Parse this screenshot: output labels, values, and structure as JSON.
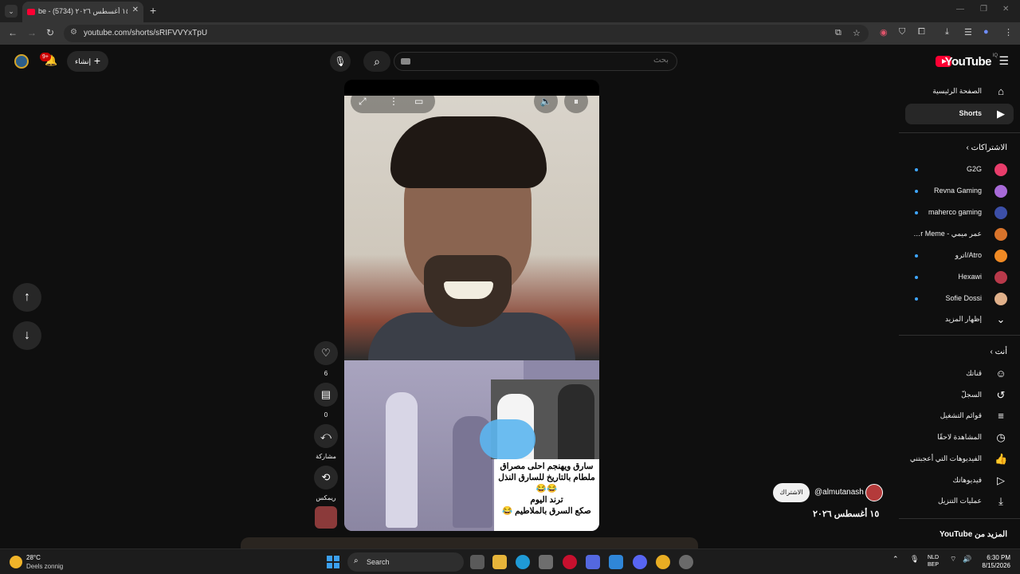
{
  "browser": {
    "tab_title": "be - ١٥ أغسطس ٢٠٢٦ (5734)",
    "url": "youtube.com/shorts/sRIFVVYxTpU"
  },
  "header": {
    "logo_text": "YouTube",
    "logo_country": "IQ",
    "search_placeholder": "بحث",
    "create_label": "إنشاء",
    "notification_count": "9+"
  },
  "sidebar": {
    "nav": [
      {
        "label": "الصفحة الرئيسية",
        "icon": "home-icon"
      },
      {
        "label": "Shorts",
        "icon": "shorts-icon",
        "active": true
      }
    ],
    "subscriptions_heading": "الاشتراكات",
    "subscriptions": [
      {
        "label": "G2G",
        "color": "#e83d6b",
        "new": true
      },
      {
        "label": "Revna Gaming",
        "color": "#a86ad8",
        "new": true
      },
      {
        "label": "maherco gaming",
        "color": "#3c4fa8",
        "new": true
      },
      {
        "label": "عمر ميمي - Omar Meme",
        "color": "#d9742b",
        "new": false
      },
      {
        "label": "Atro/اترو",
        "color": "#f08a24",
        "new": true
      },
      {
        "label": "Hexawi",
        "color": "#b8394a",
        "new": true
      },
      {
        "label": "Sofie Dossi",
        "color": "#e0b08a",
        "new": true
      }
    ],
    "show_more": "إظهار المزيد",
    "you_heading": "أنت",
    "you_items": [
      {
        "label": "قناتك",
        "icon": "channel-icon"
      },
      {
        "label": "السجلّ",
        "icon": "history-icon"
      },
      {
        "label": "قوائم التشغيل",
        "icon": "playlists-icon"
      },
      {
        "label": "المشاهدة لاحقًا",
        "icon": "watch-later-icon"
      },
      {
        "label": "الفيديوهات التي أعجبتني",
        "icon": "liked-icon"
      },
      {
        "label": "فيديوهاتك",
        "icon": "your-videos-icon"
      },
      {
        "label": "عمليات التنزيل",
        "icon": "downloads-icon"
      }
    ],
    "more_from_youtube": "المزيد من YouTube"
  },
  "short": {
    "caption_lines": [
      "سارق ويهنجم احلى مصراق",
      "ملطام بالتاريخ للسارق النذل",
      "😂😂",
      "ترند اليوم",
      "صكع السرق بالملاطيم 😂"
    ],
    "likes": "6",
    "comments": "0",
    "share_label": "مشاركة",
    "remix_label": "ريمكس",
    "channel_handle": "@almutanash",
    "subscribe_label": "الاشتراك",
    "date": "١٥ أغسطس ٢٠٢٦"
  },
  "taskbar": {
    "temperature": "28°C",
    "weather": "Deels zonnig",
    "search_label": "Search",
    "lang_line1": "NLD",
    "lang_line2": "BEP",
    "time": "6:30 PM",
    "date": "8/15/2026"
  }
}
